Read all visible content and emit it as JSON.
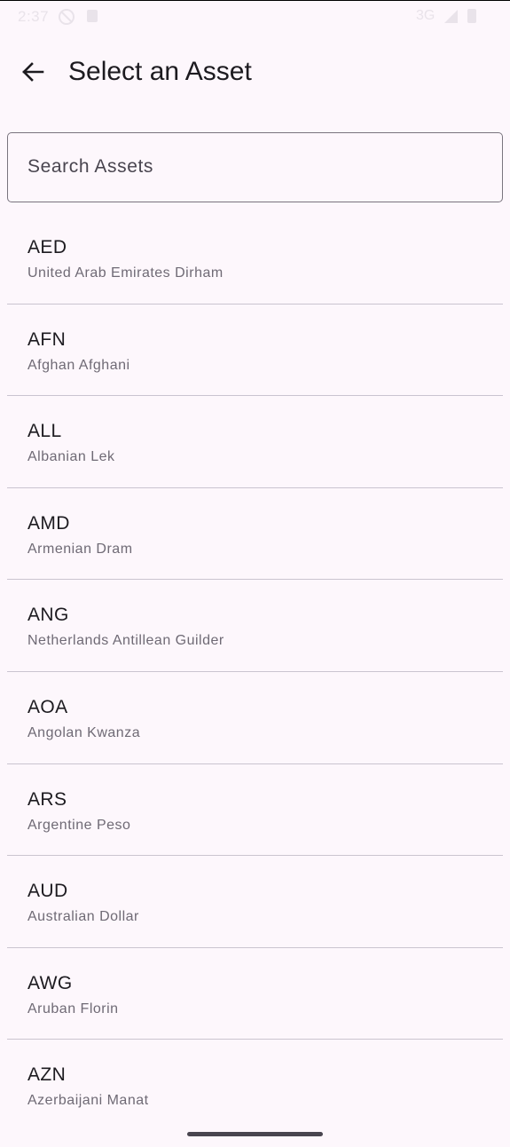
{
  "status_bar": {
    "time": "2:37",
    "network": "3G"
  },
  "header": {
    "title": "Select an Asset"
  },
  "search": {
    "placeholder": "Search Assets",
    "value": ""
  },
  "assets": [
    {
      "code": "AED",
      "name": "United Arab Emirates Dirham"
    },
    {
      "code": "AFN",
      "name": "Afghan Afghani"
    },
    {
      "code": "ALL",
      "name": "Albanian Lek"
    },
    {
      "code": "AMD",
      "name": "Armenian Dram"
    },
    {
      "code": "ANG",
      "name": "Netherlands Antillean Guilder"
    },
    {
      "code": "AOA",
      "name": "Angolan Kwanza"
    },
    {
      "code": "ARS",
      "name": "Argentine Peso"
    },
    {
      "code": "AUD",
      "name": "Australian Dollar"
    },
    {
      "code": "AWG",
      "name": "Aruban Florin"
    },
    {
      "code": "AZN",
      "name": "Azerbaijani Manat"
    }
  ],
  "icons": {
    "back": "arrow-back-icon",
    "dnd": "do-not-disturb-icon",
    "sim": "sim-card-icon",
    "signal": "cell-signal-icon",
    "battery": "battery-icon"
  },
  "colors": {
    "background": "#fdf7fc",
    "text_primary": "#1d1b20",
    "text_secondary": "#6f6a75",
    "outline": "#79747e",
    "divider": "#cac4d0"
  }
}
